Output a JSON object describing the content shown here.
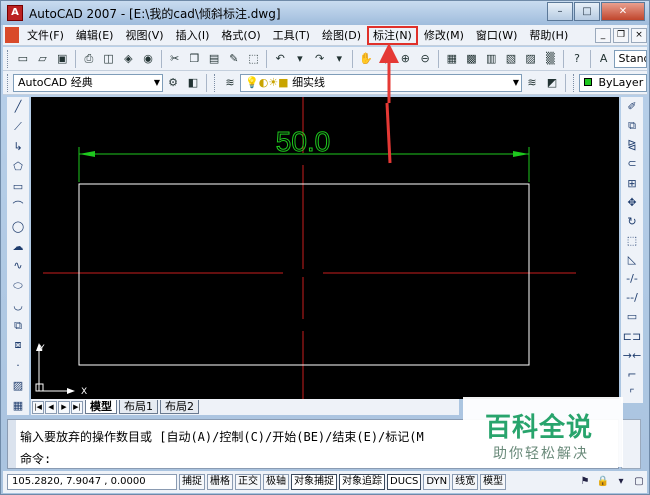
{
  "window": {
    "title": "AutoCAD 2007 - [E:\\我的cad\\倾斜标注.dwg]",
    "app_icon_glyph": "A",
    "minimize": "–",
    "maximize": "□",
    "close": "✕"
  },
  "menubar": {
    "items": [
      {
        "label": "文件(F)"
      },
      {
        "label": "编辑(E)"
      },
      {
        "label": "视图(V)"
      },
      {
        "label": "插入(I)"
      },
      {
        "label": "格式(O)"
      },
      {
        "label": "工具(T)"
      },
      {
        "label": "绘图(D)"
      },
      {
        "label": "标注(N)",
        "highlighted": true
      },
      {
        "label": "修改(M)"
      },
      {
        "label": "窗口(W)"
      },
      {
        "label": "帮助(H)"
      }
    ],
    "mdi_minimize": "_",
    "mdi_restore": "❐",
    "mdi_close": "×"
  },
  "toolbar_standard": {
    "text_style_label": "Stand"
  },
  "toolbar_workspace": {
    "workspace_value": "AutoCAD 经典",
    "layer_value": "细实线",
    "color_value": "ByLayer"
  },
  "drawing": {
    "dimension_text": "50.0",
    "ucs_x_label": "X",
    "ucs_y_label": "Y",
    "colors": {
      "background": "#000000",
      "centerline": "#c81e1e",
      "rectangle": "#ffffff",
      "dimension": "#1ec81e",
      "annotation_arrow": "#e53935"
    }
  },
  "layout_tabs": {
    "items": [
      {
        "label": "模型",
        "active": true
      },
      {
        "label": "布局1"
      },
      {
        "label": "布局2"
      }
    ]
  },
  "command": {
    "line1": "输入要放弃的操作数目或 [自动(A)/控制(C)/开始(BE)/结束(E)/标记(M",
    "line2": "命令:"
  },
  "watermark": {
    "title": "百科全说",
    "subtitle": "助你轻松解决"
  },
  "statusbar": {
    "coordinates": "105.2820, 7.9047 , 0.0000",
    "buttons": [
      {
        "label": "捕捉",
        "on": false
      },
      {
        "label": "栅格",
        "on": false
      },
      {
        "label": "正交",
        "on": false
      },
      {
        "label": "极轴",
        "on": false
      },
      {
        "label": "对象捕捉",
        "on": true
      },
      {
        "label": "对象追踪",
        "on": true
      },
      {
        "label": "DUCS",
        "on": true
      },
      {
        "label": "DYN",
        "on": false
      },
      {
        "label": "线宽",
        "on": false
      },
      {
        "label": "模型",
        "on": false
      }
    ]
  }
}
